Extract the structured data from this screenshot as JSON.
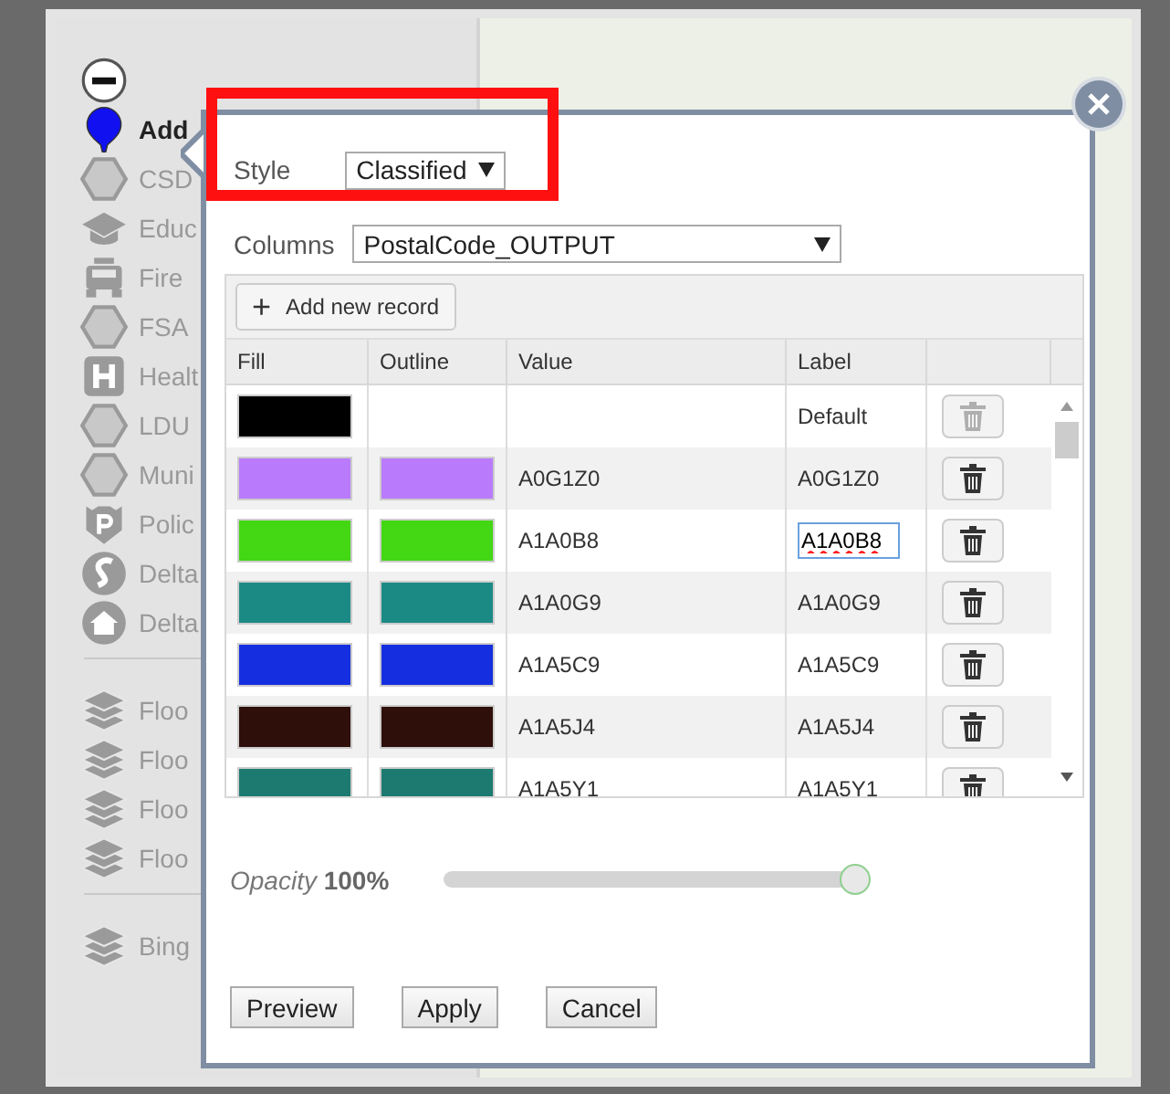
{
  "sidebar": {
    "groups": [
      {
        "items": [
          {
            "kind": "minus",
            "selected": true
          },
          {
            "kind": "pin",
            "label": "Add",
            "selected": true
          },
          {
            "kind": "hexagon",
            "label": "CSD",
            "selected": false
          },
          {
            "kind": "cap",
            "label": "Educ",
            "selected": false
          },
          {
            "kind": "truck",
            "label": "Fire",
            "selected": false
          },
          {
            "kind": "hexagon",
            "label": "FSA",
            "selected": false
          },
          {
            "kind": "hospital",
            "label": "Healt",
            "selected": false
          },
          {
            "kind": "hexagon",
            "label": "LDU",
            "selected": false
          },
          {
            "kind": "hexagon",
            "label": "Muni",
            "selected": false
          },
          {
            "kind": "police",
            "label": "Polic",
            "selected": false
          },
          {
            "kind": "swirl",
            "label": "Delta",
            "selected": false
          },
          {
            "kind": "home",
            "label": "Delta",
            "selected": false
          }
        ]
      },
      {
        "items": [
          {
            "kind": "layers",
            "label": "Floo",
            "selected": false
          },
          {
            "kind": "layers",
            "label": "Floo",
            "selected": false
          },
          {
            "kind": "layers",
            "label": "Floo",
            "selected": false
          },
          {
            "kind": "layers",
            "label": "Floo",
            "selected": false
          }
        ]
      },
      {
        "items": [
          {
            "kind": "layers",
            "label": "Bing",
            "selected": false
          }
        ]
      }
    ]
  },
  "dialog": {
    "style": {
      "label": "Style",
      "value": "Classified",
      "highlighted": true
    },
    "columns": {
      "label": "Columns",
      "value": "PostalCode_OUTPUT"
    },
    "add_button": {
      "icon": "+",
      "label": "Add new record"
    },
    "table": {
      "columns": [
        "Fill",
        "Outline",
        "Value",
        "Label"
      ],
      "rows": [
        {
          "fill": {
            "color": "#000000"
          },
          "label": "Default",
          "editing": false,
          "disabled": true
        },
        {
          "fill": {
            "color": "#b97bfb"
          },
          "outline": {
            "color": "#b97bfb"
          },
          "value": "A0G1Z0",
          "label": "A0G1Z0",
          "editing": false,
          "disabled": false
        },
        {
          "fill": {
            "color": "#43d714"
          },
          "outline": {
            "color": "#43d714"
          },
          "value": "A1A0B8",
          "label": "A1A0B8",
          "editing": true,
          "disabled": false
        },
        {
          "fill": {
            "color": "#1b8a85"
          },
          "outline": {
            "color": "#1b8a85"
          },
          "value": "A1A0G9",
          "label": "A1A0G9",
          "editing": false,
          "disabled": false
        },
        {
          "fill": {
            "color": "#152fe0"
          },
          "outline": {
            "color": "#152fe0"
          },
          "value": "A1A5C9",
          "label": "A1A5C9",
          "editing": false,
          "disabled": false
        },
        {
          "fill": {
            "color": "#2e0f09"
          },
          "outline": {
            "color": "#2e0f09"
          },
          "value": "A1A5J4",
          "label": "A1A5J4",
          "editing": false,
          "disabled": false
        },
        {
          "fill": {
            "color": "#1d7a70"
          },
          "outline": {
            "color": "#1d7a70"
          },
          "value": "A1A5Y1",
          "label": "A1A5Y1",
          "editing": false,
          "disabled": false
        }
      ]
    },
    "opacity": {
      "label": "Opacity",
      "reading": "100%",
      "level": 1
    },
    "buttons": [
      "Preview",
      "Apply",
      "Cancel"
    ]
  }
}
